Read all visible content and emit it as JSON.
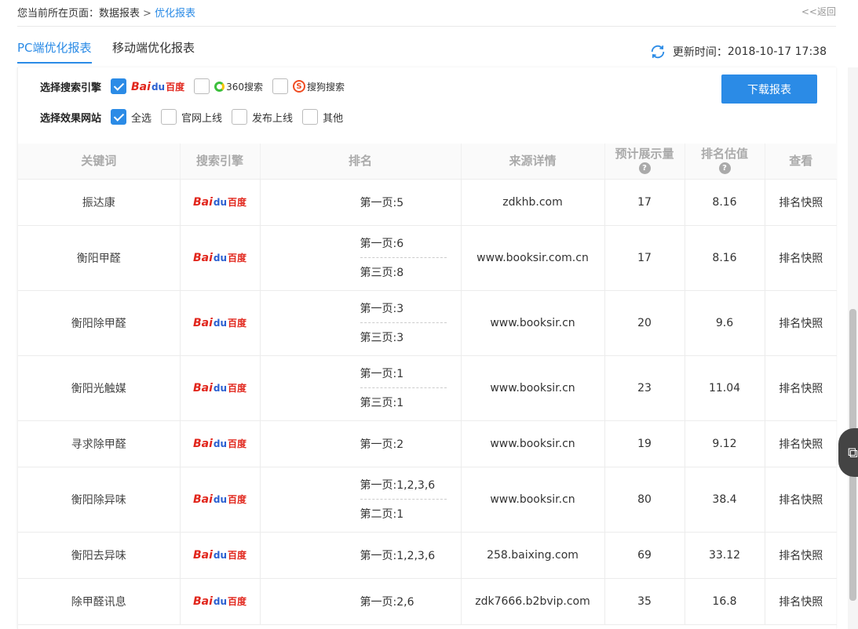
{
  "breadcrumb": {
    "prefix": "您当前所在页面：",
    "parent": "数据报表",
    "separator": ">",
    "current": "优化报表",
    "back": "<<返回"
  },
  "tabs": [
    {
      "label": "PC端优化报表",
      "active": true
    },
    {
      "label": "移动端优化报表",
      "active": false
    }
  ],
  "update": {
    "label": "更新时间：",
    "time": "2018-10-17 17:38"
  },
  "filters": {
    "engine_label": "选择搜索引擎",
    "engines": [
      {
        "logo": "baidu-logo",
        "bai": "Bai",
        "paw": "du",
        "du": "百度",
        "checked": true
      },
      {
        "logo": "360-logo",
        "text": "360搜索",
        "checked": false
      },
      {
        "logo": "sogou-logo",
        "s": "S",
        "text": "搜狗搜索",
        "checked": false
      }
    ],
    "site_label": "选择效果网站",
    "sites": [
      {
        "label": "全选",
        "checked": true
      },
      {
        "label": "官网上线",
        "checked": false
      },
      {
        "label": "发布上线",
        "checked": false
      },
      {
        "label": "其他",
        "checked": false
      }
    ]
  },
  "download_label": "下载报表",
  "table": {
    "headers": [
      "关键词",
      "搜索引擎",
      "排名",
      "来源详情",
      "预计展示量",
      "排名估值",
      "查看"
    ],
    "help_icon": "?",
    "rows": [
      {
        "keyword": "振达康",
        "ranks": [
          "第一页:5"
        ],
        "source": "zdkhb.com",
        "impressions": "17",
        "value": "8.16",
        "action": "排名快照"
      },
      {
        "keyword": "衡阳甲醛",
        "ranks": [
          "第一页:6",
          "第三页:8"
        ],
        "source": "www.booksir.com.cn",
        "impressions": "17",
        "value": "8.16",
        "action": "排名快照"
      },
      {
        "keyword": "衡阳除甲醛",
        "ranks": [
          "第一页:3",
          "第三页:3"
        ],
        "source": "www.booksir.cn",
        "impressions": "20",
        "value": "9.6",
        "action": "排名快照"
      },
      {
        "keyword": "衡阳光触媒",
        "ranks": [
          "第一页:1",
          "第三页:1"
        ],
        "source": "www.booksir.cn",
        "impressions": "23",
        "value": "11.04",
        "action": "排名快照"
      },
      {
        "keyword": "寻求除甲醛",
        "ranks": [
          "第一页:2"
        ],
        "source": "www.booksir.cn",
        "impressions": "19",
        "value": "9.12",
        "action": "排名快照"
      },
      {
        "keyword": "衡阳除异味",
        "ranks": [
          "第一页:1,2,3,6",
          "第二页:1"
        ],
        "source": "www.booksir.cn",
        "impressions": "80",
        "value": "38.4",
        "action": "排名快照"
      },
      {
        "keyword": "衡阳去异味",
        "ranks": [
          "第一页:1,2,3,6"
        ],
        "source": "258.baixing.com",
        "impressions": "69",
        "value": "33.12",
        "action": "排名快照"
      },
      {
        "keyword": "除甲醛讯息",
        "ranks": [
          "第一页:2,6"
        ],
        "source": "zdk7666.b2bvip.com",
        "impressions": "35",
        "value": "16.8",
        "action": "排名快照"
      }
    ]
  },
  "colors": {
    "accent": "#2b8be6",
    "baidu_red": "#e1261c",
    "baidu_blue": "#2a5fd1"
  }
}
